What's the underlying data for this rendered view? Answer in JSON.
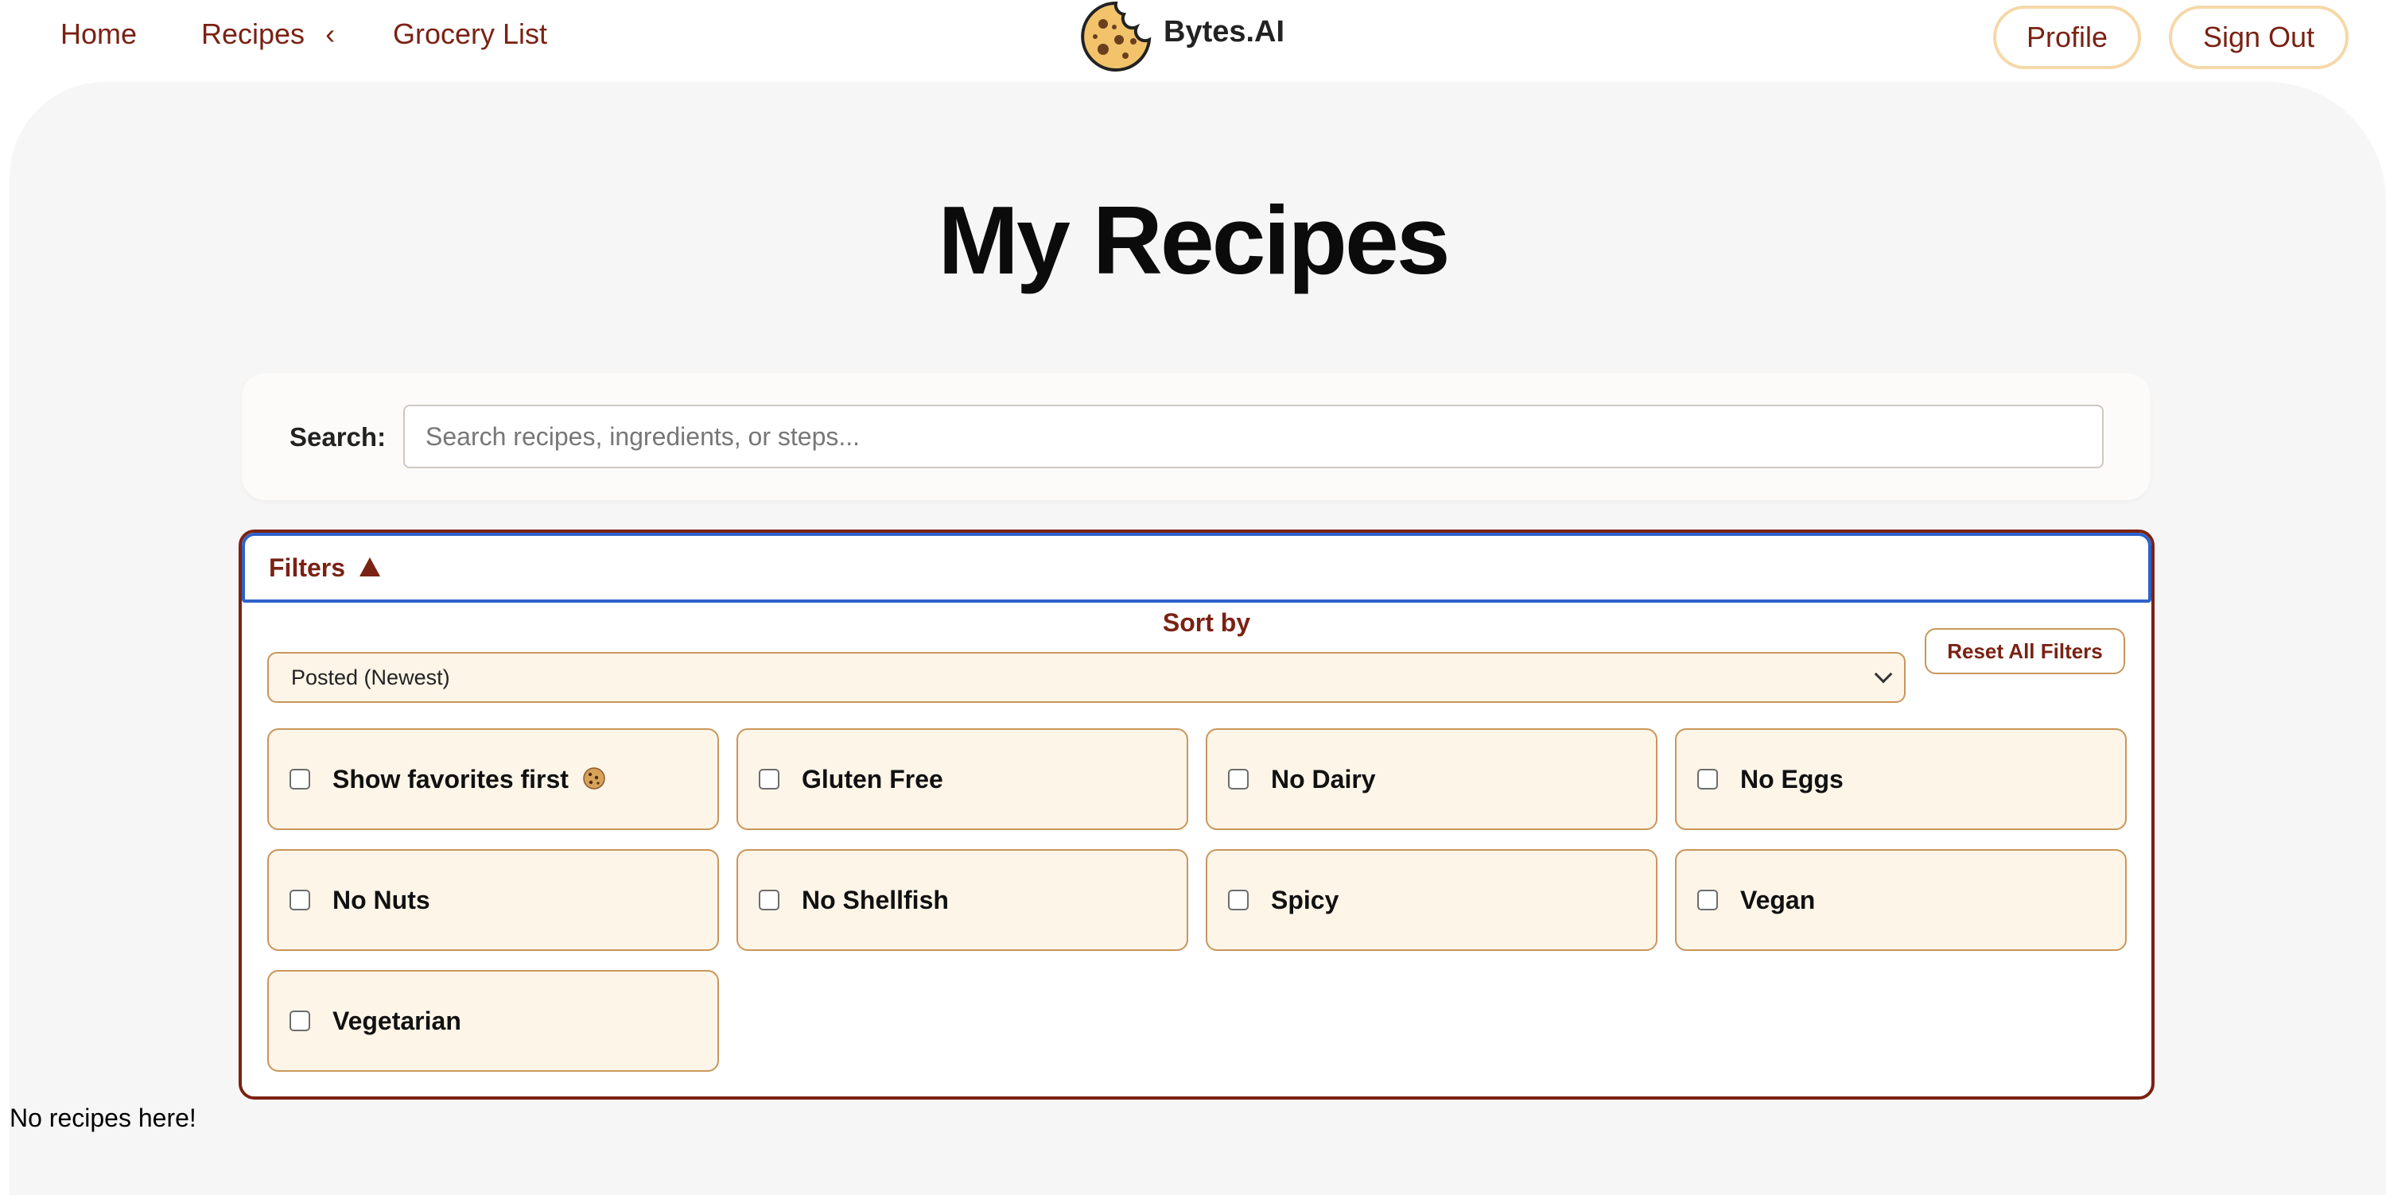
{
  "nav": {
    "home": "Home",
    "recipes": "Recipes",
    "recipes_chevron": "‹",
    "grocery": "Grocery List",
    "brand": "Bytes.AI",
    "profile": "Profile",
    "sign_out": "Sign Out"
  },
  "page": {
    "title": "My Recipes"
  },
  "search": {
    "label": "Search:",
    "value": "",
    "placeholder": "Search recipes, ingredients, or steps..."
  },
  "filters": {
    "title": "Filters",
    "sort_label": "Sort by",
    "sort_value": "Posted (Newest)",
    "reset_label": "Reset All Filters",
    "options": [
      {
        "label": "Show favorites first",
        "checked": false
      },
      {
        "label": "Gluten Free",
        "checked": false
      },
      {
        "label": "No Dairy",
        "checked": false
      },
      {
        "label": "No Eggs",
        "checked": false
      },
      {
        "label": "No Nuts",
        "checked": false
      },
      {
        "label": "No Shellfish",
        "checked": false
      },
      {
        "label": "Spicy",
        "checked": false
      },
      {
        "label": "Vegan",
        "checked": false
      },
      {
        "label": "Vegetarian",
        "checked": false
      }
    ]
  },
  "empty_state": "No recipes here!",
  "colors": {
    "accent": "#7a2214",
    "chip_bg": "#fdf5e8",
    "chip_border": "#c9965b",
    "pill_border": "#f6d8a8",
    "focus_ring": "#2d62c9",
    "page_bg": "#f6f6f6"
  },
  "icons": {
    "brand": "cookie-icon",
    "favorite": "cookie-icon",
    "filters_toggle": "triangle-up-icon",
    "select": "chevron-down-icon"
  }
}
